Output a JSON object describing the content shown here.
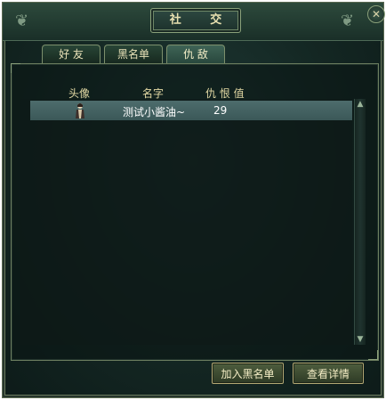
{
  "window": {
    "title": "社 交"
  },
  "tabs": [
    {
      "label": "好 友"
    },
    {
      "label": "黑名单"
    },
    {
      "label": "仇 敌"
    }
  ],
  "table": {
    "headers": [
      "头像",
      "名字",
      "仇 恨 值"
    ],
    "rows": [
      {
        "avatar": "character-avatar-icon",
        "name": "测试小酱油~",
        "hatred": "29"
      }
    ]
  },
  "buttons": {
    "add_blacklist": "加入黑名单",
    "view_details": "查看详情"
  },
  "icons": {
    "close": "✕",
    "scroll_up": "▲",
    "scroll_down": "▼"
  },
  "colors": {
    "accent": "#e3d9a4",
    "selected_row": "#4d6c6c"
  }
}
